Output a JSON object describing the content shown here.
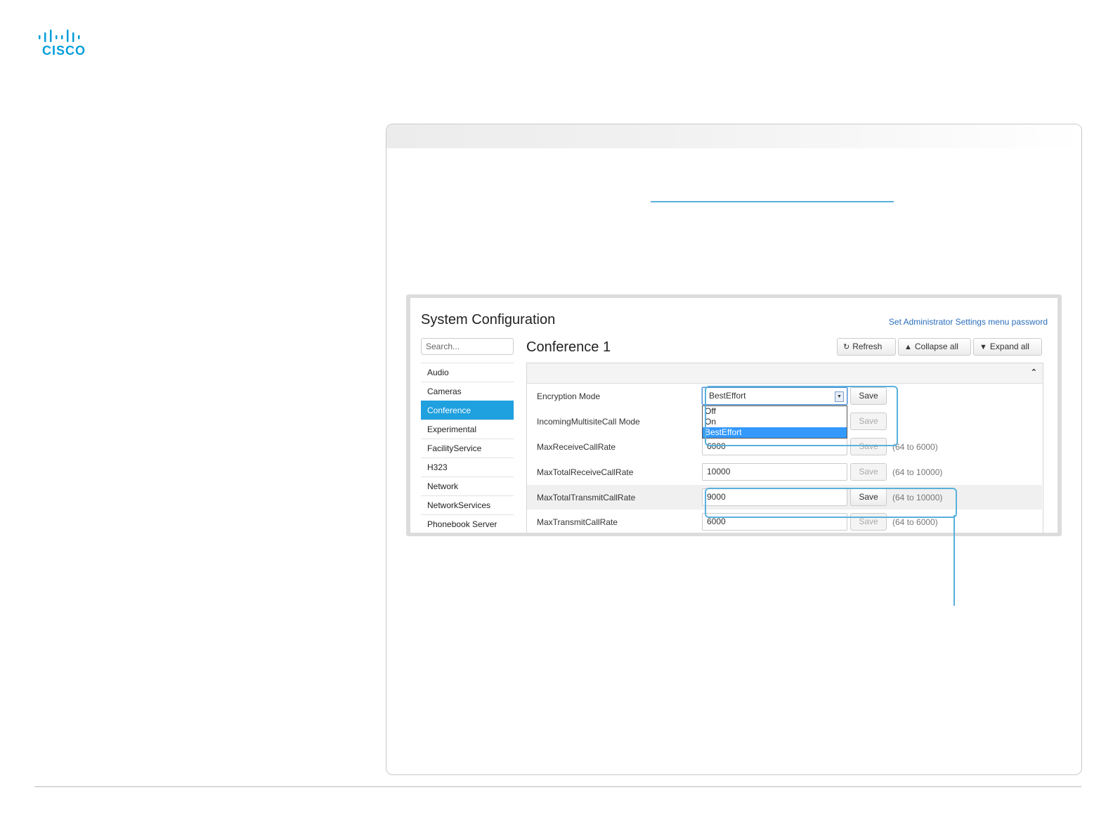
{
  "brand": {
    "logo_text": "CISCO",
    "logo_color": "#049fd9"
  },
  "screenshot": {
    "title": "System Configuration",
    "admin_link": "Set Administrator Settings menu password",
    "search_placeholder": "Search...",
    "nav": [
      {
        "label": "Audio",
        "active": false
      },
      {
        "label": "Cameras",
        "active": false
      },
      {
        "label": "Conference",
        "active": true
      },
      {
        "label": "Experimental",
        "active": false
      },
      {
        "label": "FacilityService",
        "active": false
      },
      {
        "label": "H323",
        "active": false
      },
      {
        "label": "Network",
        "active": false
      },
      {
        "label": "NetworkServices",
        "active": false
      },
      {
        "label": "Phonebook Server",
        "active": false
      }
    ],
    "section_title": "Conference 1",
    "buttons": {
      "refresh": "Refresh",
      "collapse_all": "Collapse all",
      "expand_all": "Expand all"
    },
    "rows": [
      {
        "label": "Encryption Mode",
        "value": "BestEffort",
        "save": "Save",
        "range": ""
      },
      {
        "label": "IncomingMultisiteCall Mode",
        "value": "",
        "save": "Save",
        "range": ""
      },
      {
        "label": "MaxReceiveCallRate",
        "value": "6000",
        "save": "Save",
        "range": "(64 to 6000)"
      },
      {
        "label": "MaxTotalReceiveCallRate",
        "value": "10000",
        "save": "Save",
        "range": "(64 to 10000)"
      },
      {
        "label": "MaxTotalTransmitCallRate",
        "value": "9000",
        "save": "Save",
        "range": "(64 to 10000)"
      },
      {
        "label": "MaxTransmitCallRate",
        "value": "6000",
        "save": "Save",
        "range": "(64 to 6000)"
      }
    ],
    "dropdown_options": [
      "Off",
      "On",
      "BestEffort"
    ],
    "dropdown_selected": "BestEffort",
    "accent_color": "#1fa0df",
    "callout_color": "#5ab0dc"
  }
}
